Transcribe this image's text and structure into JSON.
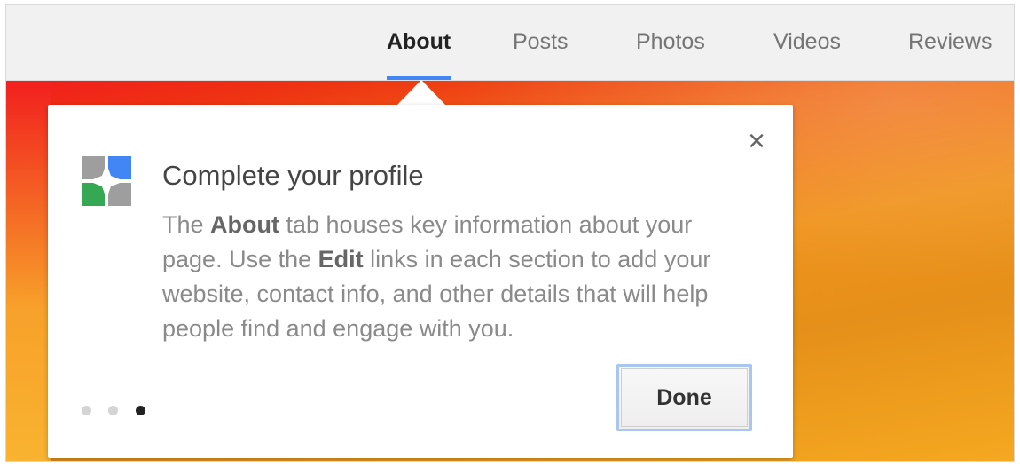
{
  "nav": {
    "tabs": [
      {
        "label": "About",
        "active": true
      },
      {
        "label": "Posts",
        "active": false
      },
      {
        "label": "Photos",
        "active": false
      },
      {
        "label": "Videos",
        "active": false
      },
      {
        "label": "Reviews",
        "active": false
      }
    ]
  },
  "popup": {
    "title": "Complete your profile",
    "description": {
      "part1": "The ",
      "bold1": "About",
      "part2": " tab houses key information about your page. Use the ",
      "bold2": "Edit",
      "part3": " links in each section to add your website, contact info, and other details that will help people find and engage with you."
    },
    "done_label": "Done",
    "close_icon": "×",
    "steps": {
      "total": 3,
      "current": 3
    }
  },
  "colors": {
    "accent": "#4285f4",
    "logo_blue": "#4285f4",
    "logo_green": "#34a853",
    "logo_gray": "#9e9e9e"
  }
}
